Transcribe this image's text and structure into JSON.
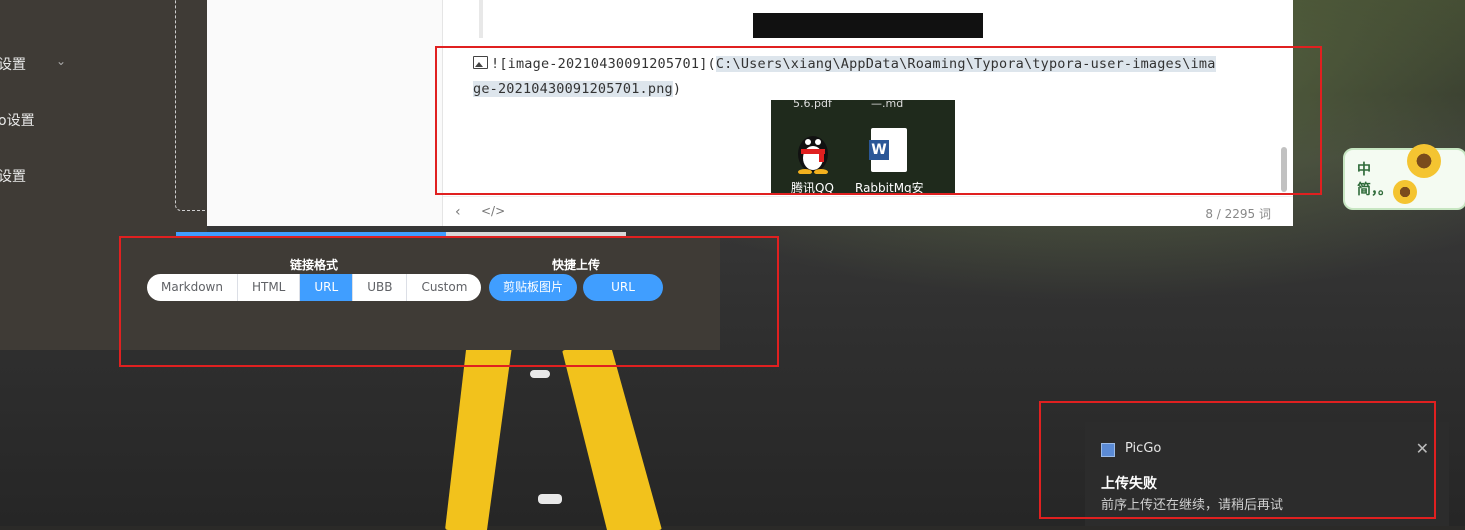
{
  "sidebar": {
    "items": [
      {
        "label": "设置"
      },
      {
        "label": "o设置"
      },
      {
        "label": "设置"
      }
    ]
  },
  "editor": {
    "markdown_prefix": "![image-20210430091205701](",
    "markdown_path_1": "C:\\Users\\xiang\\AppData\\Roaming\\Typora\\typora-user-images\\ima",
    "markdown_path_2": "ge-20210430091205701.png",
    "markdown_suffix": ")",
    "preview": {
      "top_text_left": "5.6.pdf",
      "top_text_right": "—.md",
      "icon1_label": "腾讯QQ",
      "icon2_label": "RabbitMq安"
    },
    "status": {
      "nav_symbol": "‹",
      "code_symbol": "</>",
      "word_count": "8 / 2295 词"
    }
  },
  "link_format": {
    "title": "链接格式",
    "options": [
      "Markdown",
      "HTML",
      "URL",
      "UBB",
      "Custom"
    ],
    "selected": "URL"
  },
  "quick_upload": {
    "title": "快捷上传",
    "clipboard_button": "剪贴板图片",
    "url_button": "URL"
  },
  "notification": {
    "app_name": "PicGo",
    "title": "上传失败",
    "message": "前序上传还在继续，请稍后再试",
    "close_symbol": "✕"
  },
  "sticker": {
    "line1": "中",
    "line2": "简，。"
  },
  "colors": {
    "accent": "#409eff",
    "annotation": "#e02020",
    "panel_bg": "#3f3b36"
  }
}
